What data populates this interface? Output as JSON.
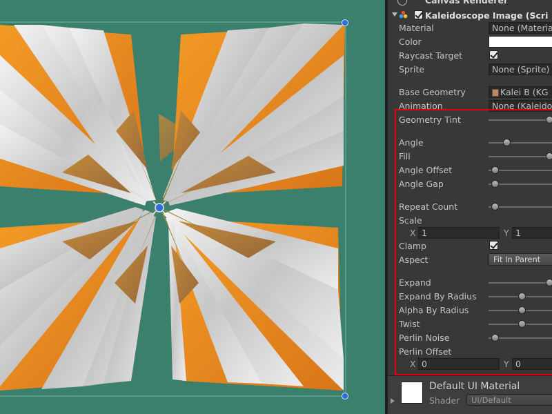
{
  "inspector": {
    "canvas_renderer_title": "Canvas Renderer",
    "component_title": "Kaleidoscope Image (Scri",
    "properties": {
      "material_label": "Material",
      "material_value": "None (Materia",
      "color_label": "Color",
      "raycast_label": "Raycast Target",
      "raycast_checked": true,
      "sprite_label": "Sprite",
      "sprite_value": "None (Sprite)",
      "base_geometry_label": "Base Geometry",
      "base_geometry_value": "Kalei B (KG",
      "animation_label": "Animation",
      "animation_value": "None (Kaleido",
      "geometry_tint_label": "Geometry Tint",
      "geometry_tint_value": 0.98,
      "angle_label": "Angle",
      "angle_value": 0.24,
      "fill_label": "Fill",
      "fill_value": 0.98,
      "angle_offset_label": "Angle Offset",
      "angle_offset_value": 0.04,
      "angle_gap_label": "Angle Gap",
      "angle_gap_value": 0.04,
      "repeat_count_label": "Repeat Count",
      "repeat_count_value": 0.04,
      "scale_label": "Scale",
      "scale_x_label": "X",
      "scale_x_value": "1",
      "scale_y_label": "Y",
      "scale_y_value": "1",
      "clamp_label": "Clamp",
      "clamp_checked": true,
      "aspect_label": "Aspect",
      "aspect_value": "Fit In Parent",
      "expand_label": "Expand",
      "expand_value": 0.98,
      "expand_by_radius_label": "Expand By Radius",
      "expand_by_radius_value": 0.5,
      "alpha_by_radius_label": "Alpha By Radius",
      "alpha_by_radius_value": 0.5,
      "twist_label": "Twist",
      "twist_value": 0.5,
      "perlin_noise_label": "Perlin Noise",
      "perlin_noise_value": 0.04,
      "perlin_offset_label": "Perlin Offset",
      "perlin_offset_x_label": "X",
      "perlin_offset_x_value": "0",
      "perlin_offset_y_label": "Y",
      "perlin_offset_y_value": "0"
    },
    "material": {
      "name": "Default UI Material",
      "shader_label": "Shader",
      "shader_value": "UI/Default"
    }
  },
  "colors": {
    "scene_background": "#3b7f6d",
    "petal_orange": "#ee8a1a",
    "petal_gray": "#cfcfcf",
    "center_olive": "#8b7f2c",
    "highlight_red": "#e0000e"
  }
}
